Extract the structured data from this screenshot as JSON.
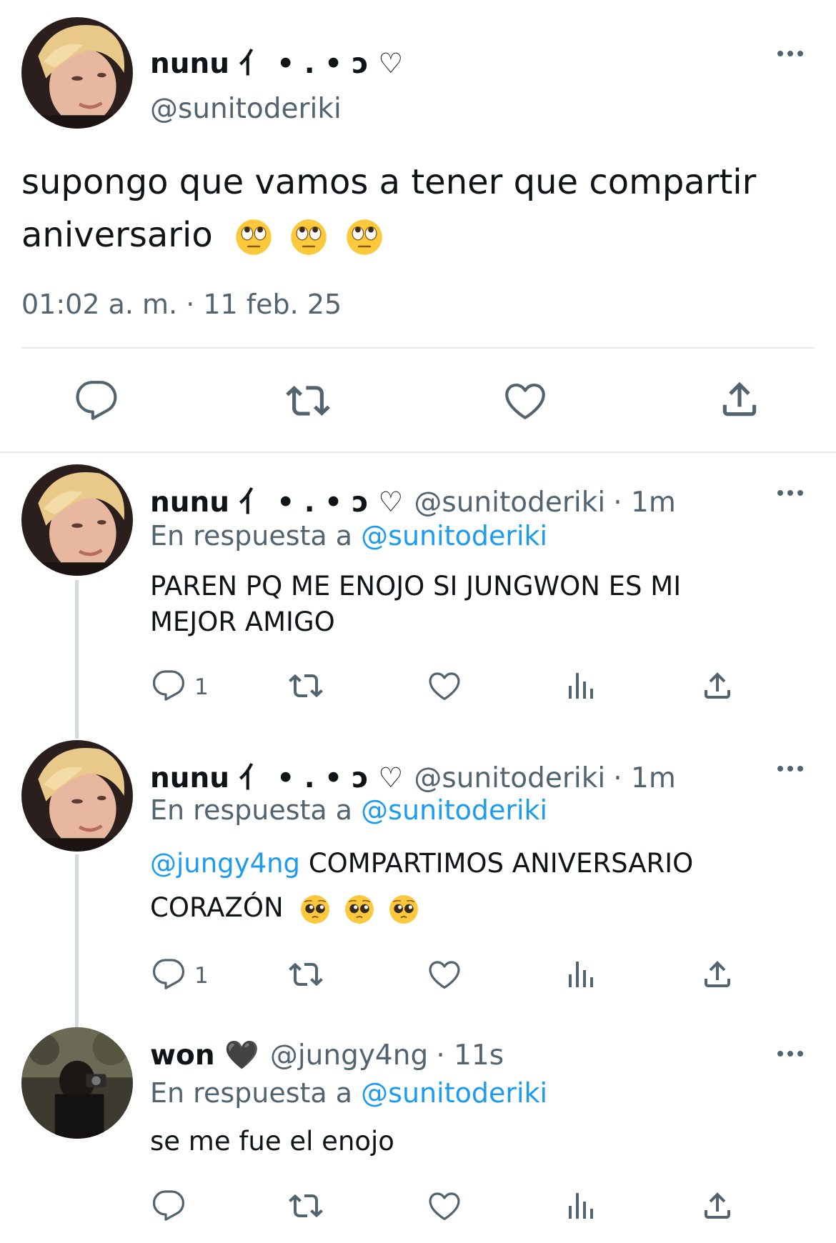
{
  "main_tweet": {
    "author_name": "nunu ⺅ • . • ɔ ♡",
    "author_handle": "@sunitoderiki",
    "text": "supongo que vamos a tener que compartir",
    "text_line2": "aniversario",
    "timestamp": "01:02 a. m. · 11 feb. 25"
  },
  "replies": [
    {
      "author_name": "nunu ⺅ • . • ɔ ♡",
      "author_handle": "@sunitoderiki",
      "time": "· 1m",
      "reply_prefix": "En respuesta a",
      "reply_to": "@sunitoderiki",
      "text_line1": "PAREN PQ ME ENOJO SI JUNGWON ES MI",
      "text_line2": "MEJOR AMIGO",
      "reply_count": "1"
    },
    {
      "author_name": "nunu ⺅ • . • ɔ ♡",
      "author_handle": "@sunitoderiki",
      "time": "· 1m",
      "reply_prefix": "En respuesta a",
      "reply_to": "@sunitoderiki",
      "mention": "@jungy4ng",
      "text_line1": "COMPARTIMOS ANIVERSARIO",
      "text_line2": "CORAZÓN",
      "reply_count": "1"
    },
    {
      "author_name": "won 🖤",
      "author_handle": "@jungy4ng",
      "time": "· 11s",
      "reply_prefix": "En respuesta a",
      "reply_to": "@sunitoderiki",
      "text_line1": "se me fue el enojo"
    }
  ],
  "icons": {
    "reply": "reply-icon",
    "retweet": "retweet-icon",
    "like": "like-icon",
    "share": "share-icon",
    "views": "views-icon",
    "more": "more-icon",
    "emoji_eyeroll": "face-with-rolling-eyes-emoji",
    "emoji_pleading": "pleading-face-emoji"
  },
  "colors": {
    "text": "#0f1419",
    "secondary": "#536471",
    "link": "#1d9bf0",
    "divider": "#e6e9ec",
    "thread_line": "#cfd9de"
  }
}
